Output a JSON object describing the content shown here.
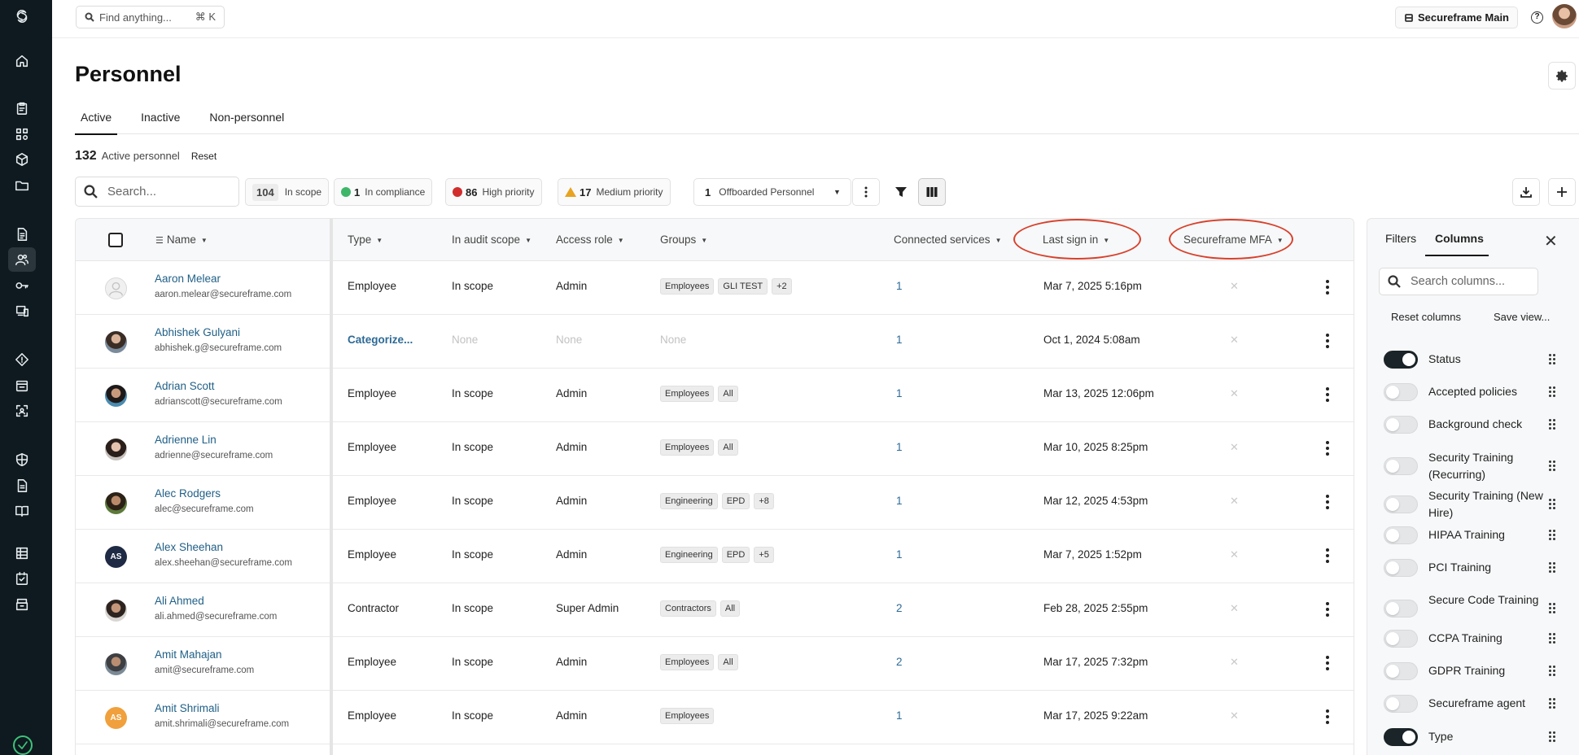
{
  "topbar": {
    "search_placeholder": "Find anything...",
    "search_shortcut": "⌘ K",
    "environment": "Secureframe Main"
  },
  "page": {
    "title": "Personnel",
    "tabs": [
      "Active",
      "Inactive",
      "Non-personnel"
    ],
    "count": "132",
    "count_label": "Active personnel",
    "reset": "Reset"
  },
  "toolbar": {
    "search_placeholder": "Search...",
    "chips": [
      {
        "count": "104",
        "label": "In scope"
      },
      {
        "count": "1",
        "label": "In compliance"
      },
      {
        "count": "86",
        "label": "High priority"
      },
      {
        "count": "17",
        "label": "Medium priority"
      }
    ],
    "offboarded": {
      "count": "1",
      "label": "Offboarded Personnel"
    }
  },
  "table": {
    "headers": {
      "name": "Name",
      "type": "Type",
      "audit": "In audit scope",
      "role": "Access role",
      "groups": "Groups",
      "services": "Connected services",
      "last_sign_in": "Last sign in",
      "mfa": "Secureframe MFA"
    },
    "rows": [
      {
        "name": "Aaron Melear",
        "email": "aaron.melear@secureframe.com",
        "type": "Employee",
        "audit": "In scope",
        "role": "Admin",
        "groups": [
          "Employees",
          "GLI TEST",
          "+2"
        ],
        "services": "1",
        "last": "Mar 7, 2025 5:16pm",
        "avatar": "placeholder"
      },
      {
        "name": "Abhishek Gulyani",
        "email": "abhishek.g@secureframe.com",
        "type": "Categorize...",
        "audit": "None",
        "role": "None",
        "groups_text": "None",
        "services": "1",
        "last": "Oct 1, 2024 5:08am",
        "avatar": "photo"
      },
      {
        "name": "Adrian Scott",
        "email": "adrianscott@secureframe.com",
        "type": "Employee",
        "audit": "In scope",
        "role": "Admin",
        "groups": [
          "Employees",
          "All"
        ],
        "services": "1",
        "last": "Mar 13, 2025 12:06pm",
        "avatar": "photo"
      },
      {
        "name": "Adrienne Lin",
        "email": "adrienne@secureframe.com",
        "type": "Employee",
        "audit": "In scope",
        "role": "Admin",
        "groups": [
          "Employees",
          "All"
        ],
        "services": "1",
        "last": "Mar 10, 2025 8:25pm",
        "avatar": "photo"
      },
      {
        "name": "Alec Rodgers",
        "email": "alec@secureframe.com",
        "type": "Employee",
        "audit": "In scope",
        "role": "Admin",
        "groups": [
          "Engineering",
          "EPD",
          "+8"
        ],
        "services": "1",
        "last": "Mar 12, 2025 4:53pm",
        "avatar": "photo"
      },
      {
        "name": "Alex Sheehan",
        "email": "alex.sheehan@secureframe.com",
        "type": "Employee",
        "audit": "In scope",
        "role": "Admin",
        "groups": [
          "Engineering",
          "EPD",
          "+5"
        ],
        "services": "1",
        "last": "Mar 7, 2025 1:52pm",
        "avatar": "initials",
        "initials": "AS",
        "color": "#1f2a44"
      },
      {
        "name": "Ali Ahmed",
        "email": "ali.ahmed@secureframe.com",
        "type": "Contractor",
        "audit": "In scope",
        "role": "Super Admin",
        "groups": [
          "Contractors",
          "All"
        ],
        "services": "2",
        "last": "Feb 28, 2025 2:55pm",
        "avatar": "photo"
      },
      {
        "name": "Amit Mahajan",
        "email": "amit@secureframe.com",
        "type": "Employee",
        "audit": "In scope",
        "role": "Admin",
        "groups": [
          "Employees",
          "All"
        ],
        "services": "2",
        "last": "Mar 17, 2025 7:32pm",
        "avatar": "photo"
      },
      {
        "name": "Amit Shrimali",
        "email": "amit.shrimali@secureframe.com",
        "type": "Employee",
        "audit": "In scope",
        "role": "Admin",
        "groups": [
          "Employees"
        ],
        "services": "1",
        "last": "Mar 17, 2025 9:22am",
        "avatar": "initials",
        "initials": "AS",
        "color": "#f0a03c"
      }
    ]
  },
  "panel": {
    "tabs": [
      "Filters",
      "Columns"
    ],
    "search_placeholder": "Search columns...",
    "reset_columns": "Reset columns",
    "save_view": "Save view...",
    "columns": [
      {
        "label": "Status",
        "on": true
      },
      {
        "label": "Accepted policies",
        "on": false
      },
      {
        "label": "Background check",
        "on": false
      },
      {
        "label": "Security Training (Recurring)",
        "on": false
      },
      {
        "label": "Security Training (New Hire)",
        "on": false
      },
      {
        "label": "HIPAA Training",
        "on": false
      },
      {
        "label": "PCI Training",
        "on": false
      },
      {
        "label": "Secure Code Training",
        "on": false
      },
      {
        "label": "CCPA Training",
        "on": false
      },
      {
        "label": "GDPR Training",
        "on": false
      },
      {
        "label": "Secureframe agent",
        "on": false
      },
      {
        "label": "Type",
        "on": true
      }
    ]
  }
}
